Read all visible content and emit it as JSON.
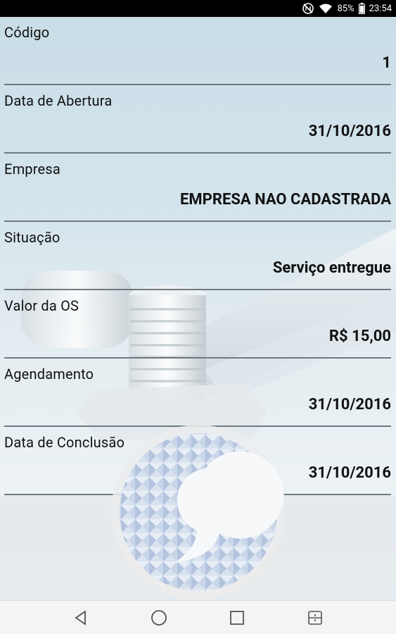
{
  "status_bar": {
    "battery": "85%",
    "time": "23:54"
  },
  "fields": [
    {
      "label": "Código",
      "value": "1"
    },
    {
      "label": "Data de Abertura",
      "value": "31/10/2016"
    },
    {
      "label": "Empresa",
      "value": "EMPRESA NAO CADASTRADA"
    },
    {
      "label": "Situação",
      "value": "Serviço entregue"
    },
    {
      "label": "Valor da OS",
      "value": "R$ 15,00"
    },
    {
      "label": "Agendamento",
      "value": "31/10/2016"
    },
    {
      "label": "Data de Conclusão",
      "value": "31/10/2016"
    }
  ],
  "nav": {
    "icons": [
      "back-icon",
      "home-icon",
      "recents-icon",
      "split-screen-icon"
    ]
  }
}
